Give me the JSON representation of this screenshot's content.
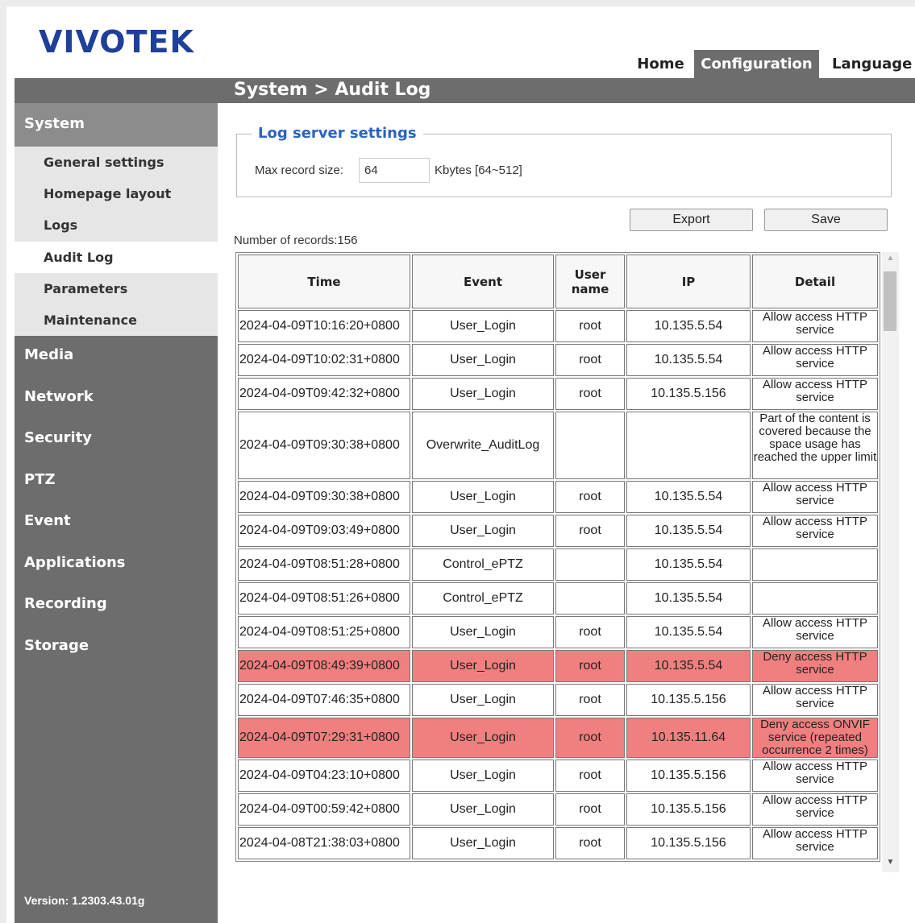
{
  "logo": "VIVOTEK",
  "topnav": {
    "home": "Home",
    "configuration": "Configuration",
    "language": "Language"
  },
  "page_title": "System  > Audit Log",
  "sidebar": {
    "system": "System",
    "items": [
      "General settings",
      "Homepage layout",
      "Logs",
      "Audit Log",
      "Parameters",
      "Maintenance"
    ],
    "sections": [
      "Media",
      "Network",
      "Security",
      "PTZ",
      "Event",
      "Applications",
      "Recording",
      "Storage"
    ],
    "version": "Version: 1.2303.43.01g"
  },
  "log_server": {
    "legend": "Log server settings",
    "max_label": "Max record size:",
    "max_value": "64",
    "units": "Kbytes [64~512]"
  },
  "buttons": {
    "export": "Export",
    "save": "Save"
  },
  "records": "Number of records:156",
  "table": {
    "headers": [
      "Time",
      "Event",
      "User name",
      "IP",
      "Detail"
    ],
    "rows": [
      {
        "time": "2024-04-09T10:16:20+0800",
        "event": "User_Login",
        "user": "root",
        "ip": "10.135.5.54",
        "detail": "Allow access HTTP service"
      },
      {
        "time": "2024-04-09T10:02:31+0800",
        "event": "User_Login",
        "user": "root",
        "ip": "10.135.5.54",
        "detail": "Allow access HTTP service"
      },
      {
        "time": "2024-04-09T09:42:32+0800",
        "event": "User_Login",
        "user": "root",
        "ip": "10.135.5.156",
        "detail": "Allow access HTTP service"
      },
      {
        "time": "2024-04-09T09:30:38+0800",
        "event": "Overwrite_AuditLog",
        "user": "",
        "ip": "",
        "detail": "Part of the content is covered because the space usage has reached the upper limit"
      },
      {
        "time": "2024-04-09T09:30:38+0800",
        "event": "User_Login",
        "user": "root",
        "ip": "10.135.5.54",
        "detail": "Allow access HTTP service"
      },
      {
        "time": "2024-04-09T09:03:49+0800",
        "event": "User_Login",
        "user": "root",
        "ip": "10.135.5.54",
        "detail": "Allow access HTTP service"
      },
      {
        "time": "2024-04-09T08:51:28+0800",
        "event": "Control_ePTZ",
        "user": "",
        "ip": "10.135.5.54",
        "detail": ""
      },
      {
        "time": "2024-04-09T08:51:26+0800",
        "event": "Control_ePTZ",
        "user": "",
        "ip": "10.135.5.54",
        "detail": ""
      },
      {
        "time": "2024-04-09T08:51:25+0800",
        "event": "User_Login",
        "user": "root",
        "ip": "10.135.5.54",
        "detail": "Allow access HTTP service"
      },
      {
        "time": "2024-04-09T08:49:39+0800",
        "event": "User_Login",
        "user": "root",
        "ip": "10.135.5.54",
        "detail": "Deny access HTTP service"
      },
      {
        "time": "2024-04-09T07:46:35+0800",
        "event": "User_Login",
        "user": "root",
        "ip": "10.135.5.156",
        "detail": "Allow access HTTP service"
      },
      {
        "time": "2024-04-09T07:29:31+0800",
        "event": "User_Login",
        "user": "root",
        "ip": "10.135.11.64",
        "detail": "Deny access ONVIF service (repeated occurrence 2 times)"
      },
      {
        "time": "2024-04-09T04:23:10+0800",
        "event": "User_Login",
        "user": "root",
        "ip": "10.135.5.156",
        "detail": "Allow access HTTP service"
      },
      {
        "time": "2024-04-09T00:59:42+0800",
        "event": "User_Login",
        "user": "root",
        "ip": "10.135.5.156",
        "detail": "Allow access HTTP service"
      },
      {
        "time": "2024-04-08T21:38:03+0800",
        "event": "User_Login",
        "user": "root",
        "ip": "10.135.5.156",
        "detail": "Allow access HTTP service"
      }
    ]
  },
  "colors": {
    "deny_row": "#f08080",
    "accent": "#2a64c0",
    "sidebar": "#6d6d6d"
  }
}
